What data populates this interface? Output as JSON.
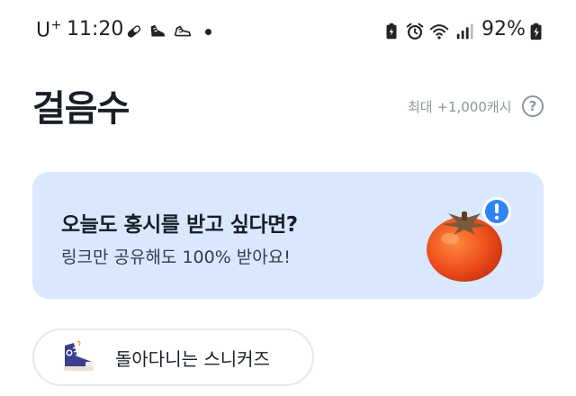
{
  "status_bar": {
    "carrier": "U",
    "carrier_sup": "+",
    "time": "11:20",
    "battery_percent": "92%",
    "left_icons": [
      "pill-icon",
      "running-shoe-icon",
      "sneaker-outline-icon"
    ],
    "right_icons": [
      "battery-saver-icon",
      "alarm-icon",
      "wifi-icon",
      "signal-icon",
      "battery-charging-icon"
    ]
  },
  "header": {
    "title": "걸음수",
    "max_reward": "최대 +1,000캐시",
    "help_icon": "help-icon",
    "help_glyph": "?"
  },
  "promo": {
    "title": "오늘도 홍시를 받고 싶다면?",
    "subtitle": "링크만 공유해도 100% 받아요!",
    "background": "#d9e8ff",
    "illustration": "persimmon-icon",
    "badge": "exclamation-badge-icon"
  },
  "chip": {
    "label": "돌아다니는 스니커즈",
    "icon": "sneaker-icon"
  },
  "colors": {
    "text_primary": "#191f28",
    "text_secondary": "#8b95a1",
    "accent_blue": "#3182f6",
    "persimmon": "#f0521f"
  }
}
